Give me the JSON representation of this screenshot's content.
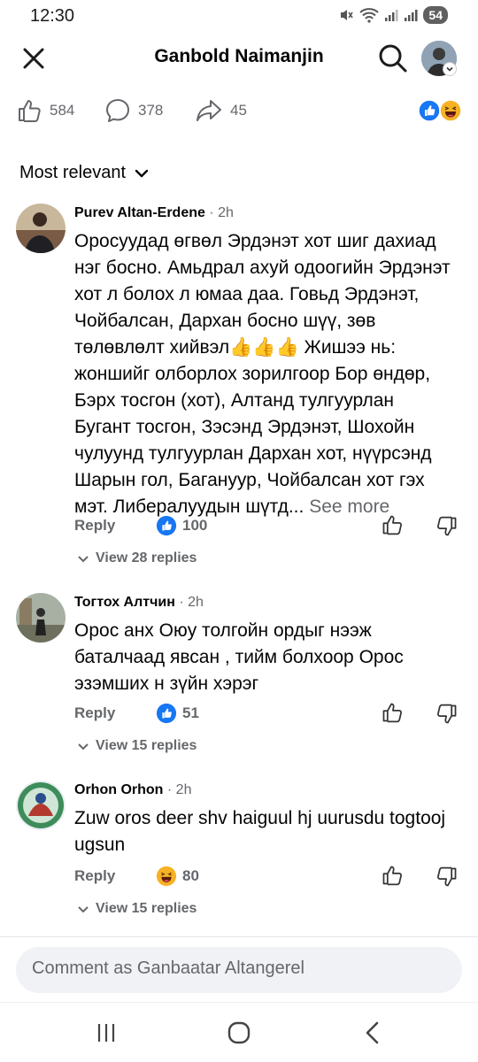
{
  "status_bar": {
    "time": "12:30",
    "battery": "54",
    "icons": [
      "mute-icon",
      "wifi-icon",
      "signal-icon",
      "signal-icon"
    ]
  },
  "header": {
    "title": "Ganbold Naimanjin",
    "close_icon": "close-icon",
    "search_icon": "search-icon"
  },
  "stats": {
    "likes": "584",
    "comments": "378",
    "shares": "45",
    "reactions": [
      "like",
      "haha"
    ]
  },
  "sort": {
    "label": "Most relevant"
  },
  "comments": [
    {
      "name": "Purev Altan-Erdene",
      "time": "· 2h",
      "text": "Оросуудад өгвөл Эрдэнэт хот шиг дахиад нэг босно. Амьдрал ахуй одоогийн Эрдэнэт хот л болох л юмаа даа. Говьд Эрдэнэт, Чойбалсан, Дархан босно шүү, зөв төлөвлөлт хийвэл👍👍👍 Жишээ нь: жоншийг олборлох зорилгоор Бор өндөр, Бэрх тосгон (хот), Алтанд тулгуурлан Бугант тосгон,  Зэсэнд Эрдэнэт, Шохойн чулуунд тулгуурлан Дархан хот, нүүрсэнд Шарын гол, Багануур, Чойбалсан хот гэх мэт. Либералуудын шүтд...",
      "see_more": " See more",
      "reply": "Reply",
      "reaction_type": "like",
      "reaction_count": "100",
      "view_replies": "View 28 replies"
    },
    {
      "name": "Тогтох Алтчин",
      "time": "· 2h",
      "text": "Орос анх Оюу толгойн ордыг нээж баталчаад явсан , тийм болхоор Орос эзэмших н зүйн хэрэг",
      "reply": "Reply",
      "reaction_type": "like",
      "reaction_count": "51",
      "view_replies": "View 15 replies"
    },
    {
      "name": "Orhon Orhon",
      "time": "· 2h",
      "text": "Zuw oros deer shv haiguul hj uurusdu togtooj ugsun",
      "reply": "Reply",
      "reaction_type": "haha",
      "reaction_count": "80",
      "view_replies": "View 15 replies"
    }
  ],
  "composer": {
    "placeholder": "Comment as Ganbaatar Altangerel"
  },
  "nav": [
    "recents-icon",
    "home-icon",
    "back-icon"
  ],
  "colors": {
    "accent": "#1877f2",
    "muted": "#65676b",
    "haha": "#f7b125"
  }
}
